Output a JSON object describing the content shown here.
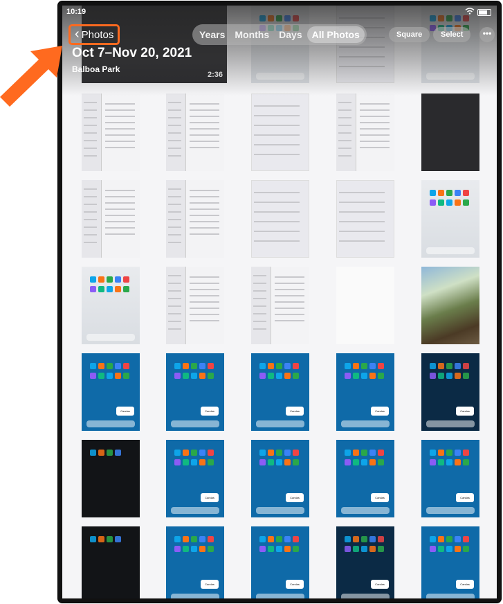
{
  "status_bar": {
    "time": "10:19",
    "wifi_icon": "wifi-icon",
    "battery_icon": "battery-icon"
  },
  "header": {
    "back_label": "Photos",
    "date_range": "Oct 7–Nov 20, 2021",
    "location": "Balboa Park"
  },
  "view_tabs": [
    {
      "label": "Years",
      "active": false
    },
    {
      "label": "Months",
      "active": false
    },
    {
      "label": "Days",
      "active": false
    },
    {
      "label": "All Photos",
      "active": true
    }
  ],
  "toolbar": {
    "square_label": "Square",
    "select_label": "Select",
    "more_icon": "ellipsis-icon"
  },
  "video": {
    "duration": "2:36"
  },
  "bubble_text": "Candas",
  "colors": {
    "annotation_arrow": "#ff6a1f",
    "wallpaper_blue": "#0f6aa8"
  }
}
